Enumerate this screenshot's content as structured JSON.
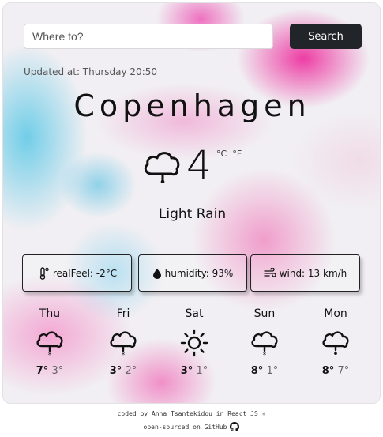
{
  "search": {
    "placeholder": "Where to?",
    "value": "",
    "button_label": "Search"
  },
  "updated": "Updated at: Thursday 20:50",
  "current": {
    "city": "Copenhagen",
    "temp": "4",
    "units": "°C |°F",
    "condition": "Light Rain",
    "icon": "cloud-rain-icon"
  },
  "stats": {
    "real_feel": "realFeel: -2°C",
    "humidity": "humidity: 93%",
    "wind": "wind: 13 km/h"
  },
  "forecast": [
    {
      "day": "Thu",
      "icon": "cloud-snow-icon",
      "hi": "7°",
      "lo": "3°"
    },
    {
      "day": "Fri",
      "icon": "cloud-snow-icon",
      "hi": "3°",
      "lo": "2°"
    },
    {
      "day": "Sat",
      "icon": "sun-icon",
      "hi": "3°",
      "lo": "1°"
    },
    {
      "day": "Sun",
      "icon": "cloud-snow-icon",
      "hi": "8°",
      "lo": "1°"
    },
    {
      "day": "Mon",
      "icon": "cloud-rain-icon",
      "hi": "8°",
      "lo": "7°"
    }
  ],
  "footer": {
    "credit": "coded by Anna Tsantekidou in React JS ⚛",
    "source": "open-sourced on GitHub"
  }
}
